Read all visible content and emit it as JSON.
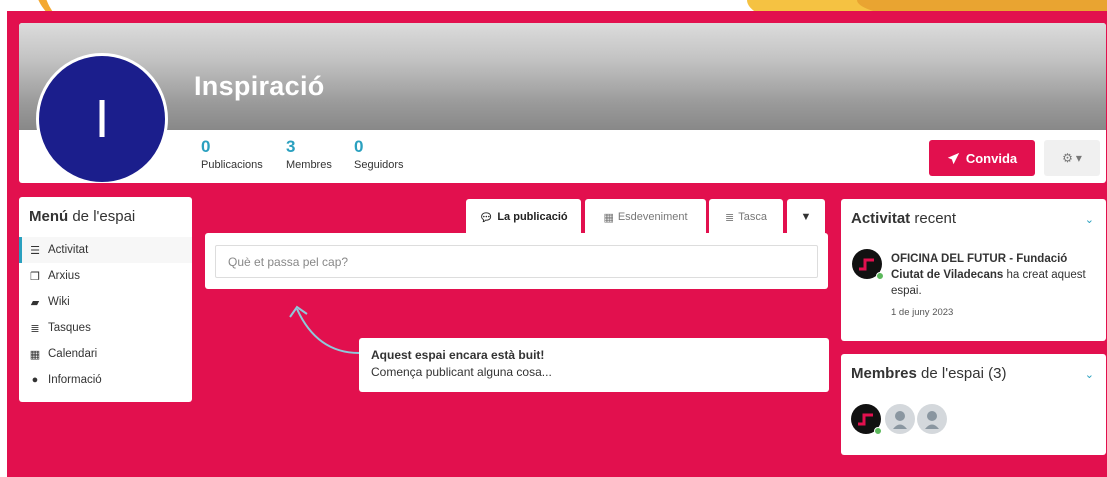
{
  "space": {
    "title": "Inspiració",
    "avatar_letter": "I"
  },
  "stats": [
    {
      "value": "0",
      "label": "Publicacions"
    },
    {
      "value": "3",
      "label": "Membres"
    },
    {
      "value": "0",
      "label": "Seguidors"
    }
  ],
  "actions": {
    "invite_label": "Convida",
    "settings_caret": "▾"
  },
  "menu": {
    "title_bold": "Menú",
    "title_rest": " de l'espai",
    "items": [
      {
        "label": "Activitat",
        "icon": "list-icon",
        "active": true
      },
      {
        "label": "Arxius",
        "icon": "files-icon",
        "active": false
      },
      {
        "label": "Wiki",
        "icon": "book-icon",
        "active": false
      },
      {
        "label": "Tasques",
        "icon": "tasks-icon",
        "active": false
      },
      {
        "label": "Calendari",
        "icon": "calendar-icon",
        "active": false
      },
      {
        "label": "Informació",
        "icon": "info-icon",
        "active": false
      }
    ]
  },
  "tabs": [
    {
      "label": "La publicació",
      "icon": "comment-icon",
      "active": true
    },
    {
      "label": "Esdeveniment",
      "icon": "calendar-icon",
      "active": false
    },
    {
      "label": "Tasca",
      "icon": "tasks-icon",
      "active": false
    }
  ],
  "composer": {
    "placeholder": "Què et passa pel cap?"
  },
  "empty_state": {
    "title": "Aquest espai encara està buit!",
    "subtitle": "Comença publicant alguna cosa..."
  },
  "activity": {
    "title_bold": "Activitat",
    "title_rest": " recent",
    "entry": {
      "actor": "OFICINA DEL FUTUR - Fundació Ciutat de Viladecans",
      "action": " ha creat aquest espai.",
      "date": "1 de juny 2023"
    }
  },
  "members": {
    "title_bold": "Membres",
    "title_rest": " de l'espai (3)"
  },
  "colors": {
    "brand": "#e2104e",
    "accent": "#2aa0bf",
    "avatar": "#1b1e8c"
  }
}
